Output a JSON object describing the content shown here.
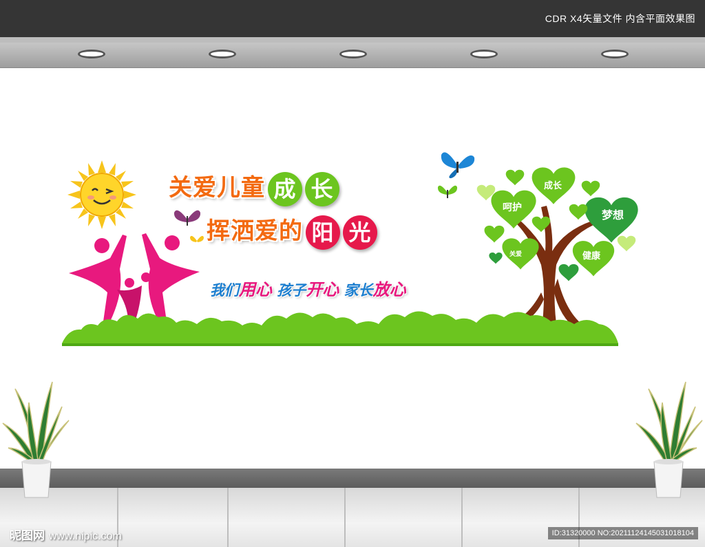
{
  "header": {
    "file_info": "CDR X4矢量文件  内含平面效果图"
  },
  "wall": {
    "title_line1": {
      "text": "关爱儿童",
      "circle1": "成",
      "circle2": "长"
    },
    "title_line2": {
      "text": "挥洒爱的",
      "circle1": "阳",
      "circle2": "光"
    },
    "slogan": {
      "part1": "我们",
      "hl1": "用心",
      "part2": "孩子",
      "hl2": "开心",
      "part3": "家长",
      "hl3": "放心"
    },
    "tree_hearts": {
      "growth": "成长",
      "care": "呵护",
      "dream": "梦想",
      "love": "关爱",
      "health": "健康"
    }
  },
  "watermark": {
    "brand": "昵图网",
    "url": "www.nipic.com",
    "id_text": "ID:31320000 NO:20211124145031018104"
  },
  "colors": {
    "title_orange": "#f36a10",
    "green": "#6cc51f",
    "dark_green": "#2e9e3c",
    "pink": "#e8197e",
    "red_circle": "#e6194b",
    "sun": "#f7c41b",
    "trunk": "#7a2e10",
    "slogan_blue": "#1d7fd0"
  },
  "icons": [
    "sun-icon",
    "butterfly-icon",
    "family-figures-icon",
    "tree-icon",
    "heart-icon",
    "potted-plant-icon",
    "ceiling-light-icon"
  ]
}
